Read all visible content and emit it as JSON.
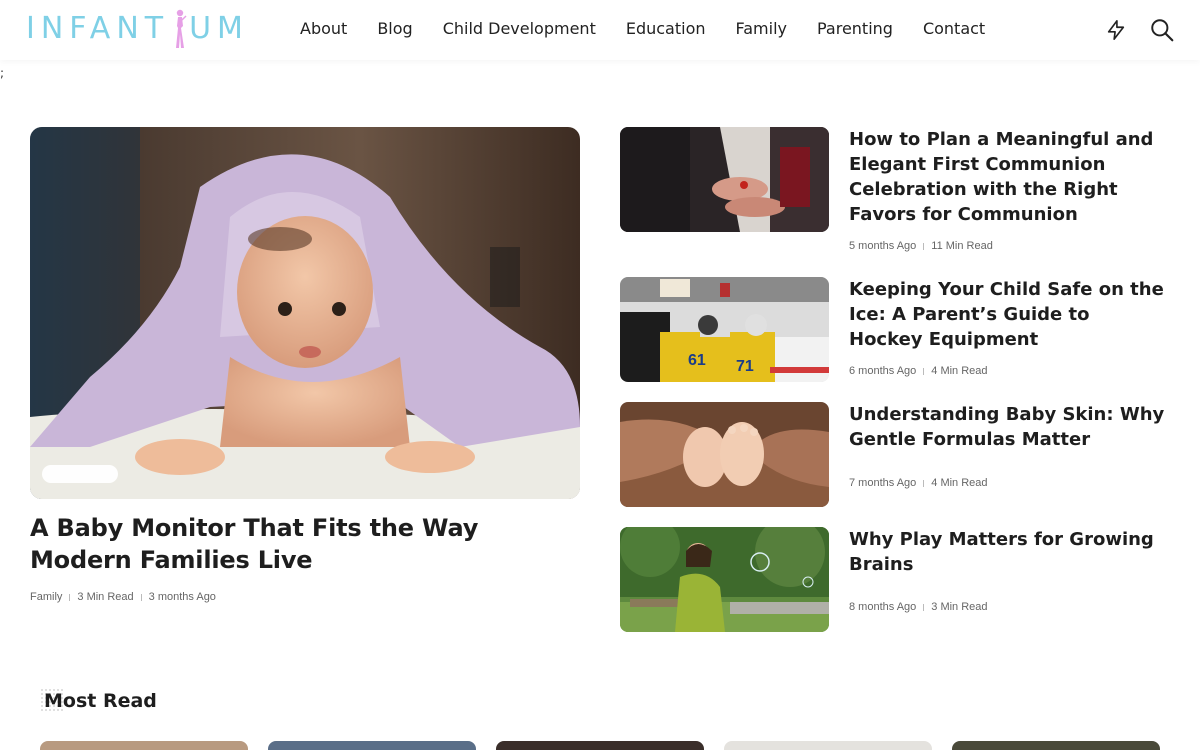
{
  "site": {
    "logo_text_left": "INFANT",
    "logo_text_right": "UM",
    "nav": [
      "About",
      "Blog",
      "Child Development",
      "Education",
      "Family",
      "Parenting",
      "Contact"
    ],
    "stray_char": ";",
    "colors": {
      "logo": "#7fd0e6",
      "logo_figure": "#e6a0e6",
      "text": "#1e1e1e",
      "meta": "#666666"
    },
    "icons": [
      "lightning-icon",
      "search-icon"
    ]
  },
  "featured": {
    "title": "A Baby Monitor That Fits the Way Modern Families Live",
    "category": "Family",
    "read_time": "3 Min Read",
    "date": "3 months Ago"
  },
  "side_posts": [
    {
      "title": "How to Plan a Meaningful and Elegant First Communion Celebration with the Right Favors for Communion",
      "date": "5 months Ago",
      "read_time": "11 Min Read"
    },
    {
      "title": "Keeping Your Child Safe on the Ice: A Parent’s Guide to Hockey Equipment",
      "date": "6 months Ago",
      "read_time": "4 Min Read"
    },
    {
      "title": "Understanding Baby Skin: Why Gentle Formulas Matter",
      "date": "7 months Ago",
      "read_time": "4 Min Read"
    },
    {
      "title": "Why Play Matters for Growing Brains",
      "date": "8 months Ago",
      "read_time": "3 Min Read"
    }
  ],
  "most_read": {
    "heading": "Most Read"
  }
}
